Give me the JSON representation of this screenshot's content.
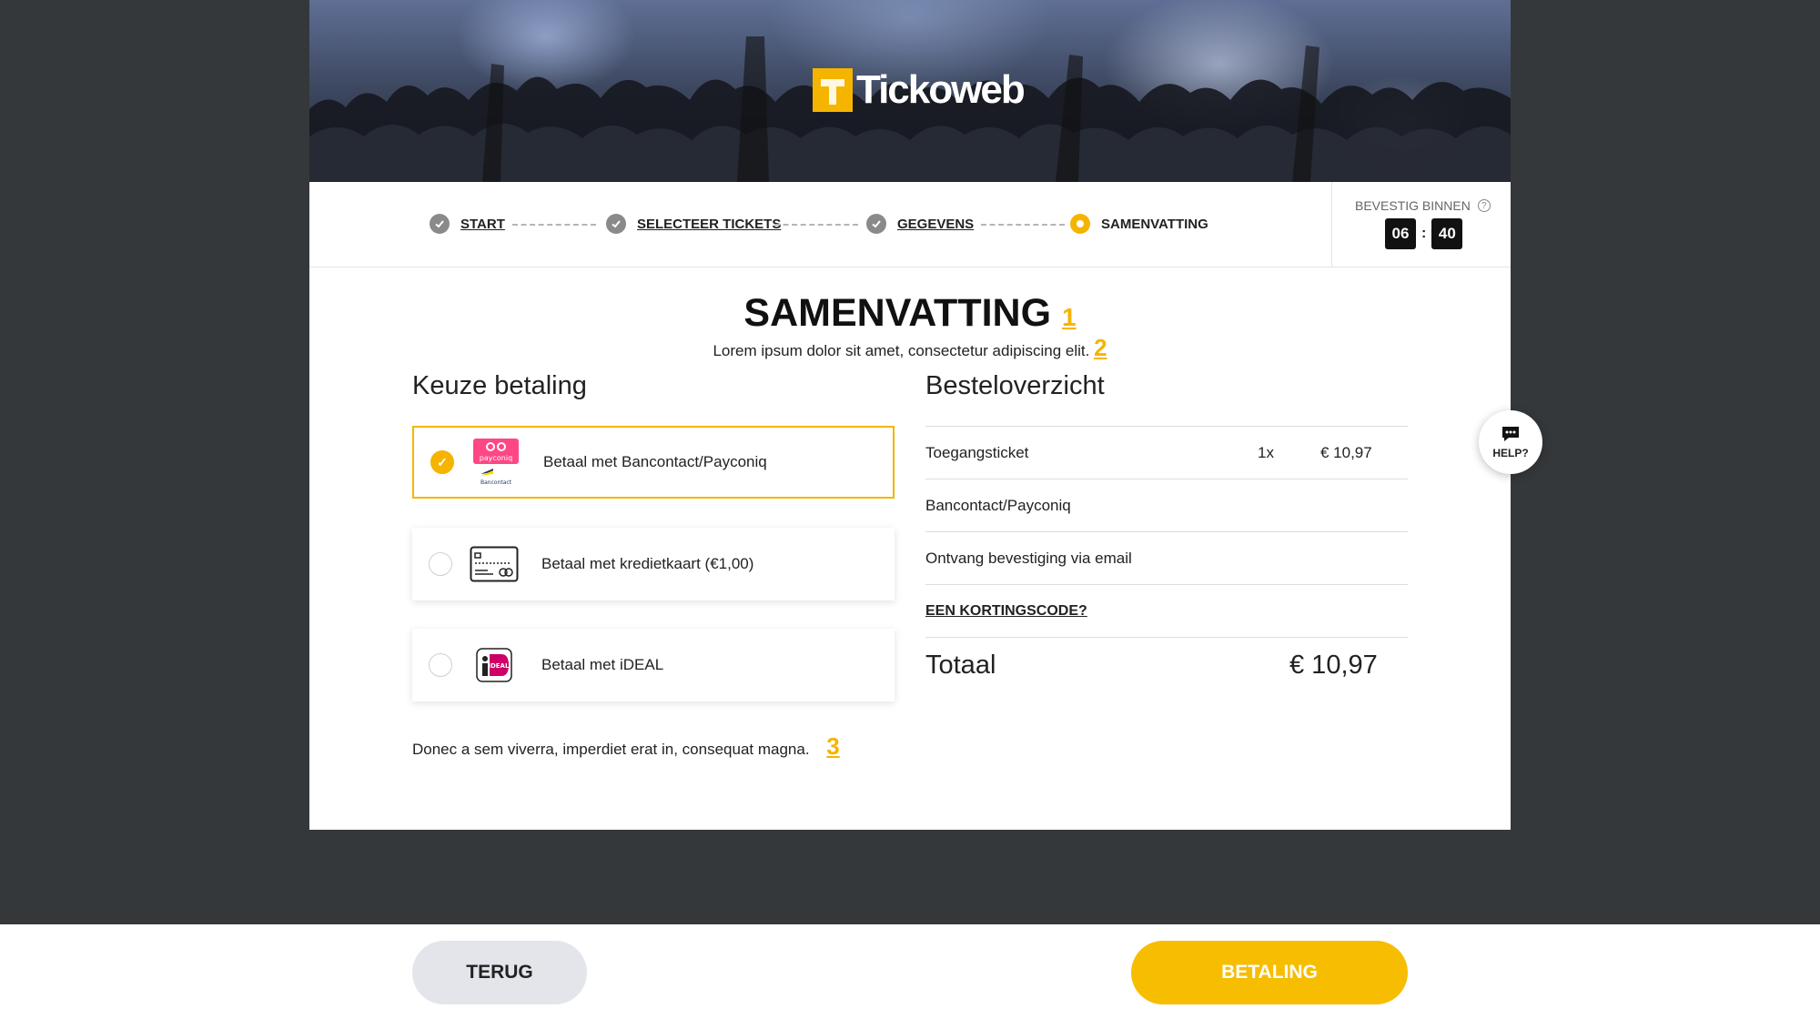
{
  "brand": {
    "name": "Tickoweb"
  },
  "steps": [
    {
      "label": "START",
      "state": "done"
    },
    {
      "label": "SELECTEER TICKETS",
      "state": "done"
    },
    {
      "label": "GEGEVENS",
      "state": "done"
    },
    {
      "label": "SAMENVATTING",
      "state": "current"
    }
  ],
  "timer": {
    "label": "BEVESTIG BINNEN",
    "minutes": "06",
    "separator": ":",
    "seconds": "40"
  },
  "page": {
    "title": "SAMENVATTING",
    "title_marker": "1",
    "subtitle": "Lorem ipsum dolor sit amet, consectetur adipiscing elit.",
    "subtitle_marker": "2"
  },
  "payment": {
    "heading": "Keuze betaling",
    "options": [
      {
        "label": "Betaal met Bancontact/Payconiq",
        "selected": true,
        "logo_text_top": "payconiq",
        "logo_text_bottom": "Bancontact"
      },
      {
        "label": "Betaal met kredietkaart (€1,00)",
        "selected": false
      },
      {
        "label": "Betaal met iDEAL",
        "selected": false,
        "logo_text": "iDEAL"
      }
    ],
    "note": "Donec a sem viverra, imperdiet erat in, consequat magna.",
    "note_marker": "3"
  },
  "summary": {
    "heading": "Besteloverzicht",
    "ticket": {
      "name": "Toegangsticket",
      "qty": "1x",
      "price": "€ 10,97"
    },
    "method": "Bancontact/Payconiq",
    "confirmation": "Ontvang bevestiging via email",
    "discount_link": "EEN KORTINGSCODE?",
    "total_label": "Totaal",
    "total_value": "€ 10,97"
  },
  "help": {
    "label": "HELP?"
  },
  "footer": {
    "back_label": "TERUG",
    "pay_label": "BETALING"
  },
  "colors": {
    "accent": "#f5b400",
    "backdrop": "#35383b"
  }
}
